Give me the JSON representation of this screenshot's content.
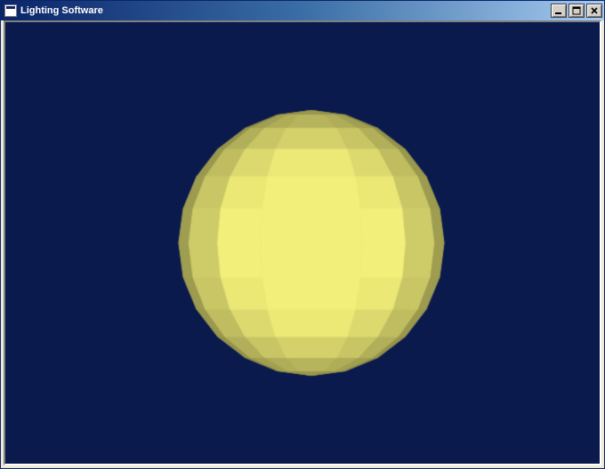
{
  "window": {
    "title": "Lighting Software"
  },
  "titlebar": {
    "minimize_tooltip": "Minimize",
    "maximize_tooltip": "Maximize",
    "close_tooltip": "Close"
  },
  "scene": {
    "background_color": "#0a1a4d",
    "object": "sphere",
    "sphere_segments_lat": 12,
    "sphere_segments_lon": 16,
    "sphere_color": "#f2ef7a",
    "light_direction": [
      0.0,
      0.0,
      1.0
    ],
    "ambient": 0.55,
    "diffuse": 0.55,
    "flat_shading": true
  }
}
